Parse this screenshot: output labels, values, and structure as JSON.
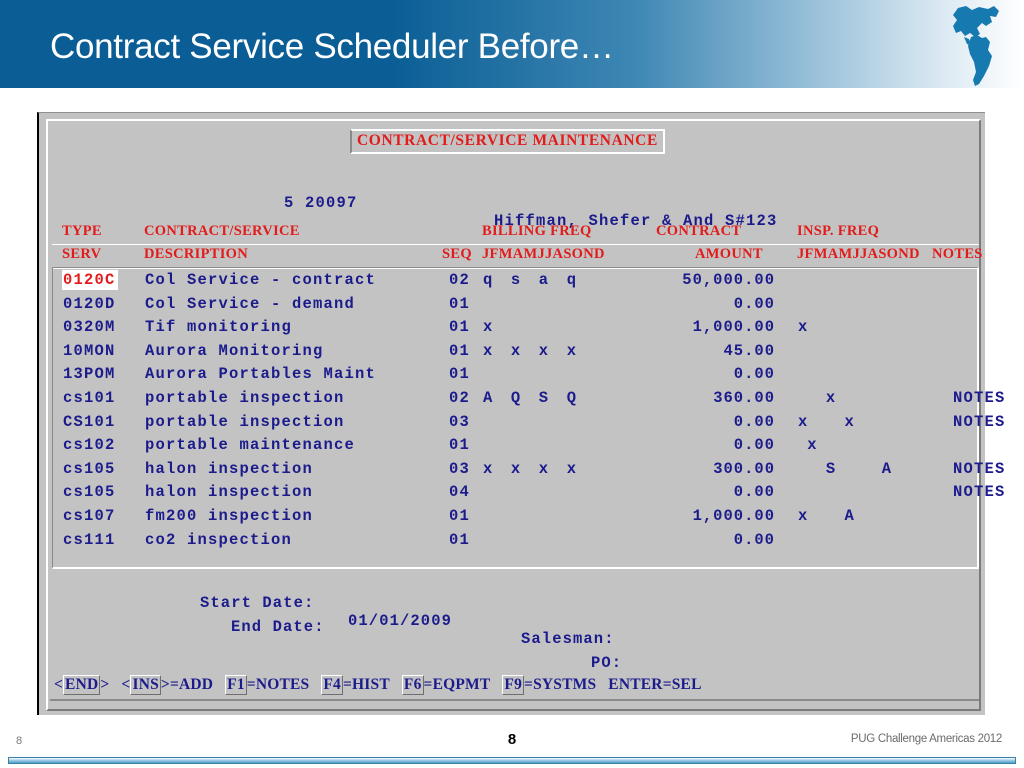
{
  "banner": {
    "title": "Contract Service Scheduler Before…",
    "bg_color": "#0a5e95",
    "logo_icon": "americas-map-icon"
  },
  "terminal": {
    "screen_title": "CONTRACT/SERVICE MAINTENANCE",
    "title_color": "#e21b1b",
    "text_color": "#1b1b8c",
    "background": "#c3c3c3",
    "customer": {
      "account": "5 20097",
      "name": "Hiffman, Shefer & And S#123"
    },
    "headers": {
      "row1": {
        "type": "TYPE",
        "contract_service": "CONTRACT/SERVICE",
        "billing_freq": "BILLING FREQ",
        "contract": "CONTRACT",
        "insp_freq": "INSP. FREQ"
      },
      "row2": {
        "serv": "SERV",
        "description": "DESCRIPTION",
        "seq": "SEQ",
        "billing_months": "JFMAMJJASOND",
        "amount": "AMOUNT",
        "insp_months": "JFMAMJJASOND",
        "notes": "NOTES"
      }
    },
    "rows": [
      {
        "type": "0120C",
        "desc": "Col Service - contract",
        "seq": "02",
        "billing": "q  s  a  q  ",
        "amount": "50,000.00",
        "insp": "            ",
        "notes": "",
        "selected": true
      },
      {
        "type": "0120D",
        "desc": "Col Service - demand",
        "seq": "01",
        "billing": "            ",
        "amount": "0.00",
        "insp": "            ",
        "notes": "",
        "selected": false
      },
      {
        "type": "0320M",
        "desc": "Tif monitoring",
        "seq": "01",
        "billing": "x           ",
        "amount": "1,000.00",
        "insp": "x           ",
        "notes": "",
        "selected": false
      },
      {
        "type": "10MON",
        "desc": "Aurora Monitoring",
        "seq": "01",
        "billing": "x  x  x  x  ",
        "amount": "45.00",
        "insp": "            ",
        "notes": "",
        "selected": false
      },
      {
        "type": "13POM",
        "desc": "Aurora Portables Maint",
        "seq": "01",
        "billing": "            ",
        "amount": "0.00",
        "insp": "            ",
        "notes": "",
        "selected": false
      },
      {
        "type": "cs101",
        "desc": "portable inspection",
        "seq": "02",
        "billing": "A  Q  S  Q  ",
        "amount": "360.00",
        "insp": "   x        ",
        "notes": "NOTES",
        "selected": false
      },
      {
        "type": "CS101",
        "desc": "portable inspection",
        "seq": "03",
        "billing": "            ",
        "amount": "0.00",
        "insp": "x    x      ",
        "notes": "NOTES",
        "selected": false
      },
      {
        "type": "cs102",
        "desc": "portable maintenance",
        "seq": "01",
        "billing": "            ",
        "amount": "0.00",
        "insp": " x          ",
        "notes": "",
        "selected": false
      },
      {
        "type": "cs105",
        "desc": "halon inspection",
        "seq": "03",
        "billing": "x  x  x  x  ",
        "amount": "300.00",
        "insp": "   S     A  ",
        "notes": "NOTES",
        "selected": false
      },
      {
        "type": "cs105",
        "desc": "halon inspection",
        "seq": "04",
        "billing": "            ",
        "amount": "0.00",
        "insp": "            ",
        "notes": "NOTES",
        "selected": false
      },
      {
        "type": "cs107",
        "desc": "fm200 inspection",
        "seq": "01",
        "billing": "            ",
        "amount": "1,000.00",
        "insp": "x    A      ",
        "notes": "",
        "selected": false
      },
      {
        "type": "cs111",
        "desc": "co2 inspection",
        "seq": "01",
        "billing": "            ",
        "amount": "0.00",
        "insp": "            ",
        "notes": "",
        "selected": false
      }
    ],
    "fields": {
      "start_date_label": "Start Date:",
      "start_date_value": "01/01/2009",
      "end_date_label": "End Date:",
      "end_date_value": "",
      "salesman_label": "Salesman:",
      "salesman_value": "",
      "po_label": "PO:",
      "po_value": ""
    },
    "function_keys": {
      "end": {
        "open": "<",
        "key": "END",
        "close": ">"
      },
      "ins": {
        "open": "<",
        "key": "INS",
        "close": ">=ADD"
      },
      "f1": {
        "key": "F1",
        "label": "=NOTES"
      },
      "f4": {
        "key": "F4",
        "label": "=HIST"
      },
      "f6": {
        "key": "F6",
        "label": "=EQPMT"
      },
      "f9": {
        "key": "F9",
        "label": "=SYSTMS"
      },
      "enter": "ENTER=SEL"
    }
  },
  "slide_footer": {
    "page_number_left": "8",
    "page_number_center": "8",
    "conference": "PUG Challenge Americas 2012"
  }
}
